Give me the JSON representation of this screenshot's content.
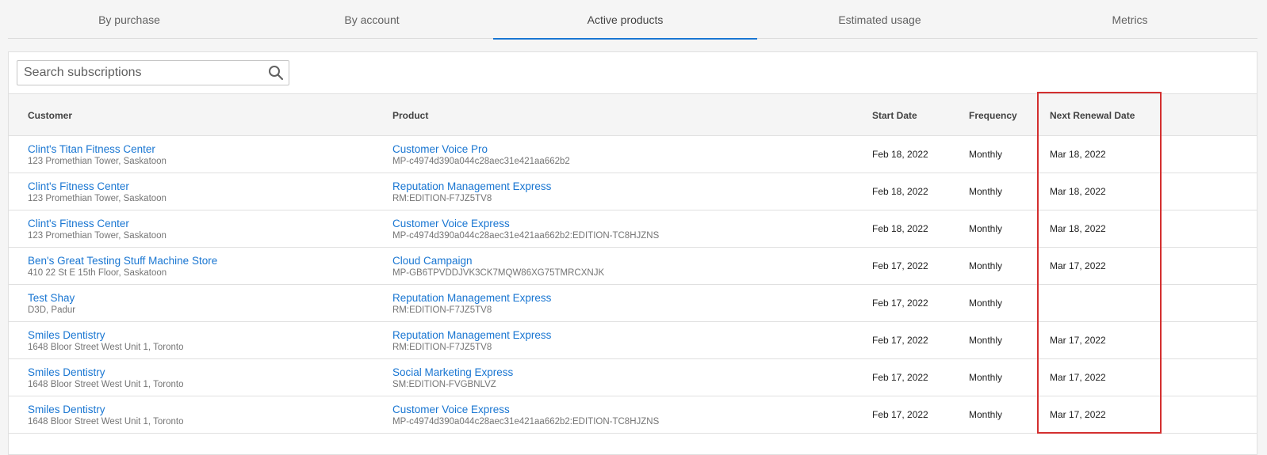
{
  "tabs": [
    {
      "label": "By purchase",
      "active": false
    },
    {
      "label": "By account",
      "active": false
    },
    {
      "label": "Active products",
      "active": true
    },
    {
      "label": "Estimated usage",
      "active": false
    },
    {
      "label": "Metrics",
      "active": false
    }
  ],
  "search": {
    "placeholder": "Search subscriptions",
    "value": "",
    "icon": "search-icon"
  },
  "table": {
    "columns": {
      "customer": "Customer",
      "product": "Product",
      "start_date": "Start Date",
      "frequency": "Frequency",
      "next_renewal": "Next Renewal Date"
    },
    "rows": [
      {
        "customer": "Clint's Titan Fitness Center",
        "address": "123 Promethian Tower, Saskatoon",
        "product": "Customer Voice Pro",
        "sku": "MP-c4974d390a044c28aec31e421aa662b2",
        "start": "Feb 18, 2022",
        "frequency": "Monthly",
        "renewal": "Mar 18, 2022"
      },
      {
        "customer": "Clint's Fitness Center",
        "address": "123 Promethian Tower, Saskatoon",
        "product": "Reputation Management Express",
        "sku": "RM:EDITION-F7JZ5TV8",
        "start": "Feb 18, 2022",
        "frequency": "Monthly",
        "renewal": "Mar 18, 2022"
      },
      {
        "customer": "Clint's Fitness Center",
        "address": "123 Promethian Tower, Saskatoon",
        "product": "Customer Voice Express",
        "sku": "MP-c4974d390a044c28aec31e421aa662b2:EDITION-TC8HJZNS",
        "start": "Feb 18, 2022",
        "frequency": "Monthly",
        "renewal": "Mar 18, 2022"
      },
      {
        "customer": "Ben's Great Testing Stuff Machine Store",
        "address": "410 22 St E 15th Floor, Saskatoon",
        "product": "Cloud Campaign",
        "sku": "MP-GB6TPVDDJVK3CK7MQW86XG75TMRCXNJK",
        "start": "Feb 17, 2022",
        "frequency": "Monthly",
        "renewal": "Mar 17, 2022"
      },
      {
        "customer": "Test Shay",
        "address": "D3D, Padur",
        "product": "Reputation Management Express",
        "sku": "RM:EDITION-F7JZ5TV8",
        "start": "Feb 17, 2022",
        "frequency": "Monthly",
        "renewal": ""
      },
      {
        "customer": "Smiles Dentistry",
        "address": "1648 Bloor Street West Unit 1, Toronto",
        "product": "Reputation Management Express",
        "sku": "RM:EDITION-F7JZ5TV8",
        "start": "Feb 17, 2022",
        "frequency": "Monthly",
        "renewal": "Mar 17, 2022"
      },
      {
        "customer": "Smiles Dentistry",
        "address": "1648 Bloor Street West Unit 1, Toronto",
        "product": "Social Marketing Express",
        "sku": "SM:EDITION-FVGBNLVZ",
        "start": "Feb 17, 2022",
        "frequency": "Monthly",
        "renewal": "Mar 17, 2022"
      },
      {
        "customer": "Smiles Dentistry",
        "address": "1648 Bloor Street West Unit 1, Toronto",
        "product": "Customer Voice Express",
        "sku": "MP-c4974d390a044c28aec31e421aa662b2:EDITION-TC8HJZNS",
        "start": "Feb 17, 2022",
        "frequency": "Monthly",
        "renewal": "Mar 17, 2022"
      }
    ]
  },
  "colors": {
    "accent": "#1976d2",
    "highlight": "#d32f2f"
  }
}
